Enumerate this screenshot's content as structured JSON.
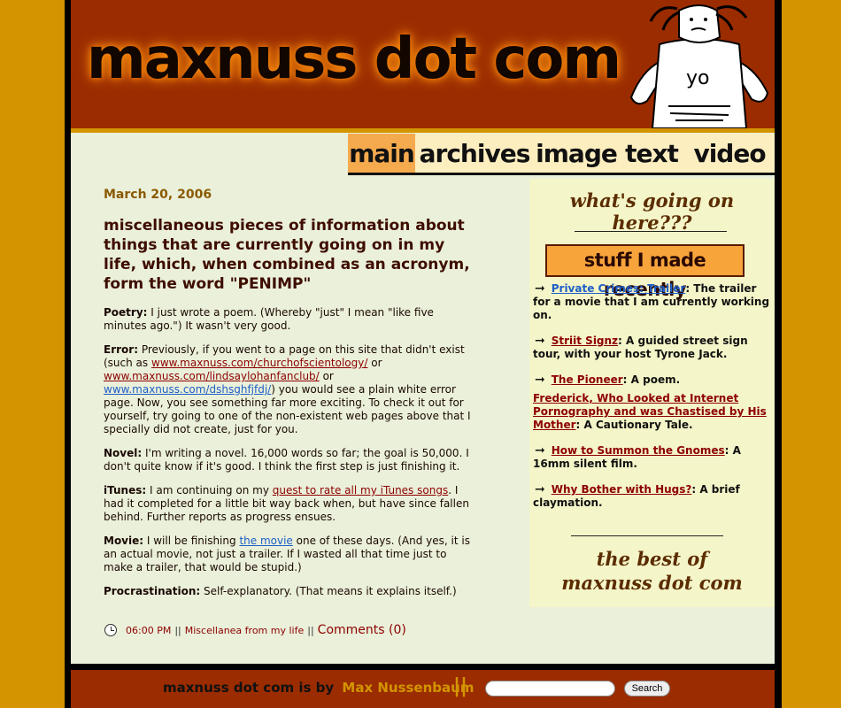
{
  "header": {
    "site_title": "maxnuss dot com",
    "mascot_shirt_text": "yo"
  },
  "nav": {
    "tabs": [
      {
        "label": "main",
        "active": true
      },
      {
        "label": "archives",
        "active": false
      },
      {
        "label": "image",
        "active": false
      },
      {
        "label": "text",
        "active": false
      },
      {
        "label": "video",
        "active": false
      }
    ]
  },
  "post": {
    "date": "March 20, 2006",
    "title": "miscellaneous pieces of information about things that are currently going on in my life, which, when combined as an acronym, form the word \"PENIMP\"",
    "poetry": {
      "label": "Poetry:",
      "text": "I just wrote a poem. (Whereby \"just\" I mean \"like five minutes ago.\") It wasn't very good."
    },
    "error": {
      "label": "Error:",
      "text_1": "Previously, if you went to a page on this site that didn't exist (such as",
      "link_1": "www.maxnuss.com/churchofscientology/",
      "text_2": "or",
      "link_2": "www.maxnuss.com/lindsaylohanfanclub/",
      "text_3": "or",
      "link_3": "www.maxnuss.com/dshsghfjfdj/",
      "text_4": ") you would see a plain white error page. Now, you see something far more exciting. To check it out for yourself, try going to one of the non-existent web pages above that I specially did not create, just for you."
    },
    "novel": {
      "label": "Novel:",
      "text": "I'm writing a novel. 16,000 words so far; the goal is 50,000. I don't quite know if it's good. I think the first step is just finishing it."
    },
    "itunes": {
      "label": "iTunes:",
      "text_1": "I am continuing on my",
      "link": "quest to rate all my iTunes songs",
      "text_2": ". I had it completed for a little bit way back when, but have since fallen behind. Further reports as progress ensues."
    },
    "movie": {
      "label": "Movie:",
      "text_1": "I will be finishing",
      "link": "the movie",
      "text_2": "one of these days. (And yes, it is an actual movie, not just a trailer. If I wasted all that time just to make a trailer, that would be stupid.)"
    },
    "procrastination": {
      "label": "Procrastination:",
      "text": "Self-explanatory. (That means it explains itself.)"
    },
    "footer": {
      "time": "06:00 PM",
      "separator": "||",
      "category": "Miscellanea from my life",
      "comments": "Comments (0)"
    }
  },
  "sidebar": {
    "heading": "what's going on here???",
    "box_title": "stuff I made recently",
    "items": [
      {
        "link": "Private Crimes: Trailer",
        "desc": ": The trailer for a movie that I am currently working on."
      },
      {
        "link": "Striit Signz",
        "desc": ": A guided street sign tour, with your host Tyrone Jack."
      },
      {
        "link": "The Pioneer",
        "desc": ": A poem."
      },
      {
        "link": "Frederick, Who Looked at Internet Pornography and was Chastised by His Mother",
        "desc": ": A Cautionary Tale."
      },
      {
        "link": "How to Summon the Gnomes",
        "desc": ": A 16mm silent film."
      },
      {
        "link": "Why Bother with Hugs?",
        "desc": ": A brief claymation."
      }
    ],
    "arrow": "➞",
    "best_of_line1": "the best of",
    "best_of_line2": "maxnuss dot com"
  },
  "footer": {
    "byline": "maxnuss dot com is by",
    "author": "Max Nussenbaum",
    "separator": "||",
    "search_placeholder": "",
    "search_button": "Search"
  },
  "colors": {
    "page_bg": "#d39400",
    "header_bg": "#9a2c00",
    "content_bg": "#eaf0da",
    "sidebar_bg": "#f4f5c8",
    "active_tab": "#f6aa4e",
    "link_red": "#8d0000",
    "link_blue": "#1f5fc7"
  }
}
